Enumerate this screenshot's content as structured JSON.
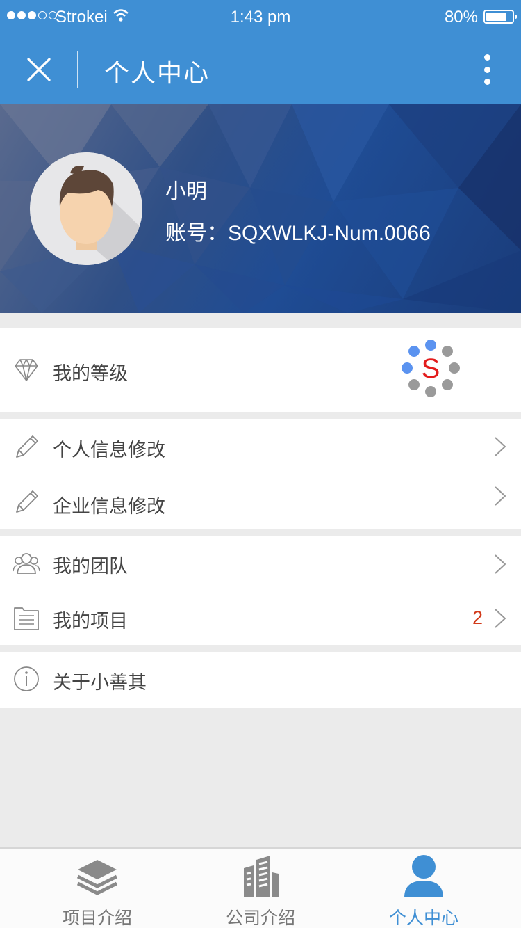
{
  "status_bar": {
    "carrier": "Strokei",
    "time": "1:43 pm",
    "battery": "80%",
    "battery_level": 0.8
  },
  "nav": {
    "title": "个人中心",
    "close_icon": "close-icon",
    "more_icon": "more-vertical-icon"
  },
  "profile": {
    "name": "小明",
    "account": "账号：SQXWLKJ-Num.0066"
  },
  "menu": {
    "level": {
      "label": "我的等级",
      "icon": "diamond-icon",
      "badge_letter": "S"
    },
    "personal_info": {
      "label": "个人信息修改",
      "icon": "pencil-icon"
    },
    "company_info": {
      "label": "企业信息修改",
      "icon": "pencil-icon"
    },
    "team": {
      "label": "我的团队",
      "icon": "team-icon"
    },
    "projects": {
      "label": "我的项目",
      "icon": "list-icon",
      "count": "2"
    },
    "about": {
      "label": "关于小善其",
      "icon": "info-icon"
    }
  },
  "tabs": [
    {
      "label": "项目介绍",
      "icon": "layers-icon",
      "active": false
    },
    {
      "label": "公司介绍",
      "icon": "building-icon",
      "active": false
    },
    {
      "label": "个人中心",
      "icon": "person-icon",
      "active": true
    }
  ],
  "colors": {
    "primary": "#3f8fd4",
    "badge_red": "#d23a1a",
    "level_blue": "#5b93f0",
    "level_gray": "#9a9a9a"
  }
}
